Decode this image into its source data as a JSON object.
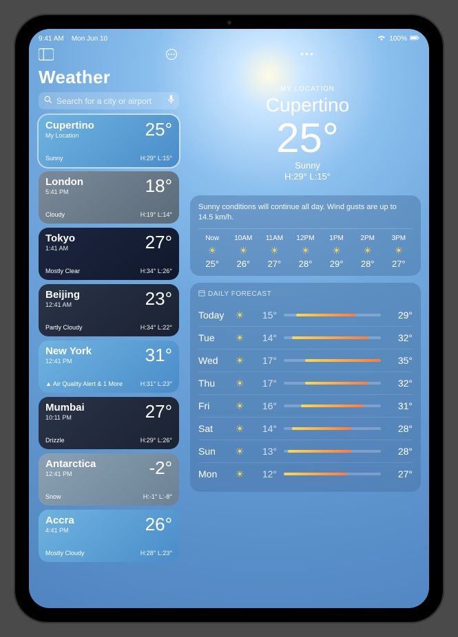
{
  "statusbar": {
    "time": "9:41 AM",
    "date": "Mon Jun 10",
    "battery": "100%"
  },
  "sidebar": {
    "title": "Weather",
    "search_placeholder": "Search for a city or airport"
  },
  "cities": [
    {
      "name": "Cupertino",
      "sub": "My Location",
      "temp": "25°",
      "cond": "Sunny",
      "hl": "H:29°  L:15°",
      "bg": "bg-sunny",
      "sel": true
    },
    {
      "name": "London",
      "sub": "5:41 PM",
      "temp": "18°",
      "cond": "Cloudy",
      "hl": "H:19°  L:14°",
      "bg": "bg-cloudy"
    },
    {
      "name": "Tokyo",
      "sub": "1:41 AM",
      "temp": "27°",
      "cond": "Mostly Clear",
      "hl": "H:34°  L:26°",
      "bg": "bg-night"
    },
    {
      "name": "Beijing",
      "sub": "12:41 AM",
      "temp": "23°",
      "cond": "Partly Cloudy",
      "hl": "H:34°  L:22°",
      "bg": "bg-nightclouds"
    },
    {
      "name": "New York",
      "sub": "12:41 PM",
      "temp": "31°",
      "cond": "▲ Air Quality Alert & 1 More",
      "hl": "H:31°  L:23°",
      "bg": "bg-sunny"
    },
    {
      "name": "Mumbai",
      "sub": "10:11 PM",
      "temp": "27°",
      "cond": "Drizzle",
      "hl": "H:29°  L:26°",
      "bg": "bg-nightclouds"
    },
    {
      "name": "Antarctica",
      "sub": "12:41 PM",
      "temp": "-2°",
      "cond": "Snow",
      "hl": "H:-1°  L:-8°",
      "bg": "bg-snow"
    },
    {
      "name": "Accra",
      "sub": "4:41 PM",
      "temp": "26°",
      "cond": "Mostly Cloudy",
      "hl": "H:28°  L:23°",
      "bg": "bg-sunny"
    }
  ],
  "location": {
    "label": "MY LOCATION",
    "city": "Cupertino",
    "temp": "25°",
    "cond": "Sunny",
    "hl": "H:29°  L:15°"
  },
  "forecast_text": "Sunny conditions will continue all day. Wind gusts are up to 14.5 km/h.",
  "hourly": [
    {
      "t": "Now",
      "v": "25°"
    },
    {
      "t": "10AM",
      "v": "26°"
    },
    {
      "t": "11AM",
      "v": "27°"
    },
    {
      "t": "12PM",
      "v": "28°"
    },
    {
      "t": "1PM",
      "v": "29°"
    },
    {
      "t": "2PM",
      "v": "28°"
    },
    {
      "t": "3PM",
      "v": "27°"
    }
  ],
  "daily_title": "DAILY FORECAST",
  "daily": [
    {
      "d": "Today",
      "lo": "15°",
      "hi": "29°",
      "l": 15,
      "h": 29
    },
    {
      "d": "Tue",
      "lo": "14°",
      "hi": "32°",
      "l": 14,
      "h": 32
    },
    {
      "d": "Wed",
      "lo": "17°",
      "hi": "35°",
      "l": 17,
      "h": 35
    },
    {
      "d": "Thu",
      "lo": "17°",
      "hi": "32°",
      "l": 17,
      "h": 32
    },
    {
      "d": "Fri",
      "lo": "16°",
      "hi": "31°",
      "l": 16,
      "h": 31
    },
    {
      "d": "Sat",
      "lo": "14°",
      "hi": "28°",
      "l": 14,
      "h": 28
    },
    {
      "d": "Sun",
      "lo": "13°",
      "hi": "28°",
      "l": 13,
      "h": 28
    },
    {
      "d": "Mon",
      "lo": "12°",
      "hi": "27°",
      "l": 12,
      "h": 27
    }
  ],
  "range": {
    "min": 12,
    "max": 35
  }
}
